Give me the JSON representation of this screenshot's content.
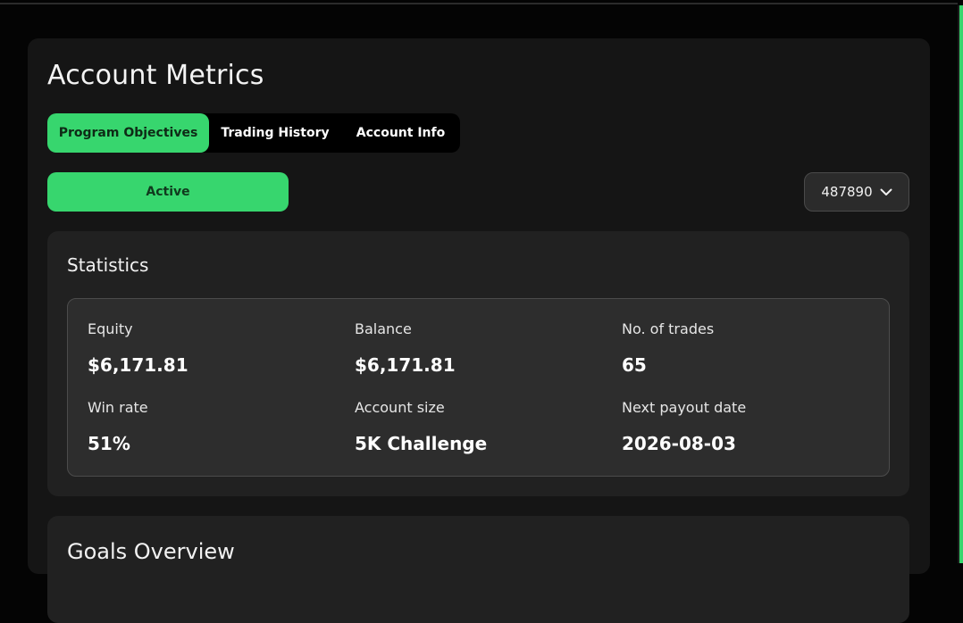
{
  "page": {
    "title": "Account Metrics"
  },
  "tabs": [
    {
      "label": "Program Objectives",
      "active": true
    },
    {
      "label": "Trading History",
      "active": false
    },
    {
      "label": "Account Info",
      "active": false
    }
  ],
  "status": {
    "label": "Active"
  },
  "account_select": {
    "value": "487890",
    "icon": "chevron-down-icon"
  },
  "statistics": {
    "title": "Statistics",
    "items": [
      {
        "label": "Equity",
        "value": "$6,171.81"
      },
      {
        "label": "Balance",
        "value": "$6,171.81"
      },
      {
        "label": "No. of trades",
        "value": "65"
      },
      {
        "label": "Win rate",
        "value": "51%"
      },
      {
        "label": "Account size",
        "value": "5K Challenge"
      },
      {
        "label": "Next payout date",
        "value": "2026-08-03"
      }
    ]
  },
  "goals": {
    "title": "Goals Overview"
  },
  "colors": {
    "accent": "#37d66e",
    "background": "#040404",
    "card": "#151515",
    "panel": "#212121"
  }
}
